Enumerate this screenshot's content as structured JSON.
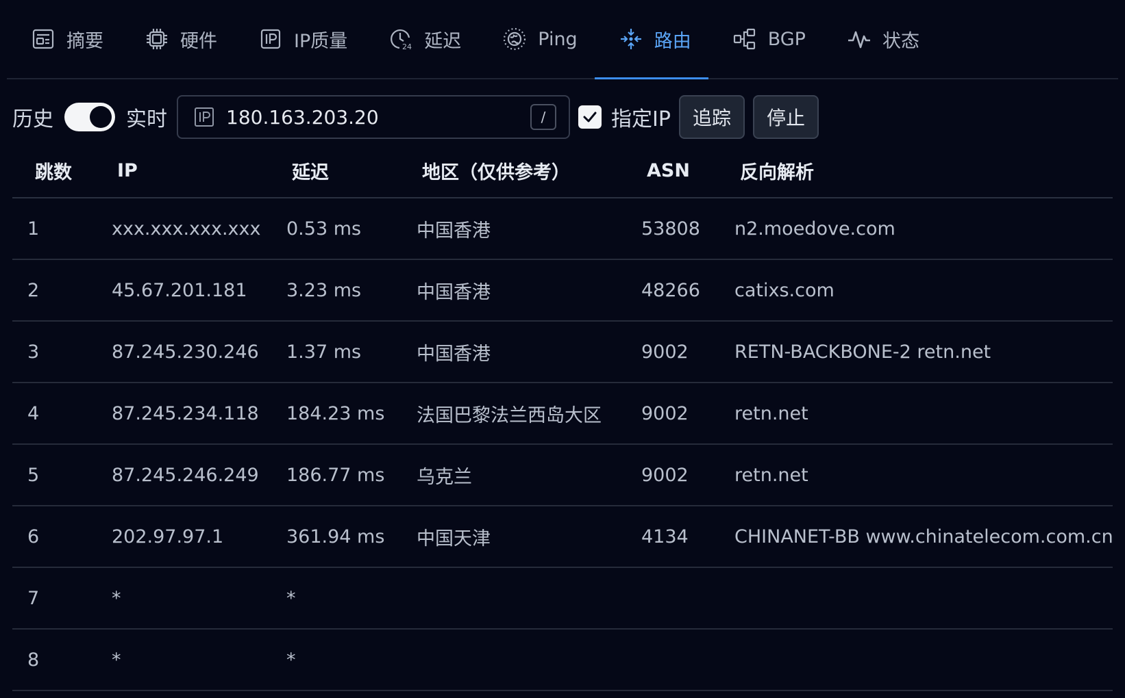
{
  "tabs": [
    {
      "label": "摘要",
      "icon": "summary-icon"
    },
    {
      "label": "硬件",
      "icon": "cpu-icon"
    },
    {
      "label": "IP质量",
      "icon": "ip-icon"
    },
    {
      "label": "延迟",
      "icon": "latency-clock-icon"
    },
    {
      "label": "Ping",
      "icon": "globe-icon"
    },
    {
      "label": "路由",
      "icon": "route-icon",
      "active": true
    },
    {
      "label": "BGP",
      "icon": "bgp-network-icon"
    },
    {
      "label": "状态",
      "icon": "activity-icon"
    }
  ],
  "toolbar": {
    "history_label": "历史",
    "realtime_label": "实时",
    "ip_value": "180.163.203.20",
    "shortcut_key": "/",
    "specify_ip_label": "指定IP",
    "trace_label": "追踪",
    "stop_label": "停止"
  },
  "table": {
    "headers": {
      "hop": "跳数",
      "ip": "IP",
      "latency": "延迟",
      "region": "地区（仅供参考）",
      "asn": "ASN",
      "rdns": "反向解析"
    },
    "rows": [
      {
        "hop": "1",
        "ip": "xxx.xxx.xxx.xxx",
        "latency": "0.53 ms",
        "region": "中国香港",
        "asn": "53808",
        "rdns": "n2.moedove.com"
      },
      {
        "hop": "2",
        "ip": "45.67.201.181",
        "latency": "3.23 ms",
        "region": "中国香港",
        "asn": "48266",
        "rdns": "catixs.com"
      },
      {
        "hop": "3",
        "ip": "87.245.230.246",
        "latency": "1.37 ms",
        "region": "中国香港",
        "asn": "9002",
        "rdns": "RETN-BACKBONE-2 retn.net"
      },
      {
        "hop": "4",
        "ip": "87.245.234.118",
        "latency": "184.23 ms",
        "region": "法国巴黎法兰西岛大区",
        "asn": "9002",
        "rdns": "retn.net"
      },
      {
        "hop": "5",
        "ip": "87.245.246.249",
        "latency": "186.77 ms",
        "region": "乌克兰",
        "asn": "9002",
        "rdns": "retn.net"
      },
      {
        "hop": "6",
        "ip": "202.97.97.1",
        "latency": "361.94 ms",
        "region": "中国天津",
        "asn": "4134",
        "rdns": "CHINANET-BB www.chinatelecom.com.cn"
      },
      {
        "hop": "7",
        "ip": "*",
        "latency": "*",
        "region": "",
        "asn": "",
        "rdns": ""
      },
      {
        "hop": "8",
        "ip": "*",
        "latency": "*",
        "region": "",
        "asn": "",
        "rdns": ""
      }
    ]
  },
  "colors": {
    "background": "#050817",
    "accent": "#3d8ef0",
    "active_tab_text": "#5aa4f5",
    "text": "#c3cad8"
  }
}
